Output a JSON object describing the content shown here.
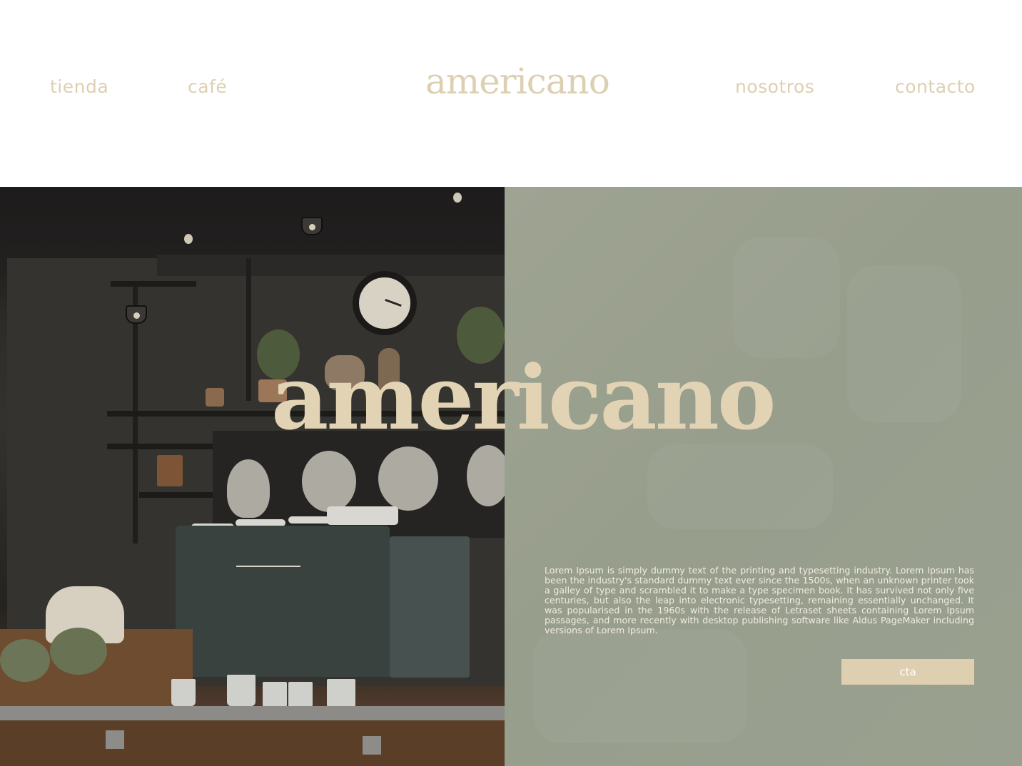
{
  "header": {
    "nav_left": [
      {
        "label": "tienda"
      },
      {
        "label": "café"
      }
    ],
    "logo": "americano",
    "nav_right": [
      {
        "label": "nosotros"
      },
      {
        "label": "contacto"
      }
    ]
  },
  "hero": {
    "title": "americano",
    "body": "Lorem Ipsum is simply dummy text of the printing and typesetting industry. Lorem Ipsum has been the industry's standard dummy text ever since the 1500s, when an unknown printer took a galley of type and scrambled it to make a type specimen book. It has survived not only five centuries, but also the leap into electronic typesetting, remaining essentially unchanged. It was popularised in the 1960s with the release of Letraset sheets containing Lorem Ipsum passages, and more recently with desktop publishing software like Aldus PageMaker including versions of Lorem Ipsum.",
    "cta_label": "cta",
    "image_description": "coffee-shop-counter-photo"
  },
  "colors": {
    "accent": "#ddd0b2",
    "panel": "#9ca190",
    "photo_dark": "#2b2a28"
  }
}
